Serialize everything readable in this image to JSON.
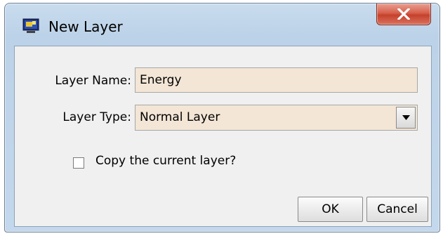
{
  "window": {
    "title": "New Layer",
    "app_icon": "computer-window-icon",
    "close_icon": "close-x-icon"
  },
  "form": {
    "layer_name_label": "Layer Name:",
    "layer_name_value": "Energy",
    "layer_type_label": "Layer Type:",
    "layer_type_value": "Normal Layer",
    "copy_checkbox_label": "Copy the current layer?",
    "copy_checked": false
  },
  "buttons": {
    "ok": "OK",
    "cancel": "Cancel"
  },
  "colors": {
    "input_background": "#f3e6d6",
    "close_button": "#c5412c",
    "frame": "#bcd2e8"
  }
}
